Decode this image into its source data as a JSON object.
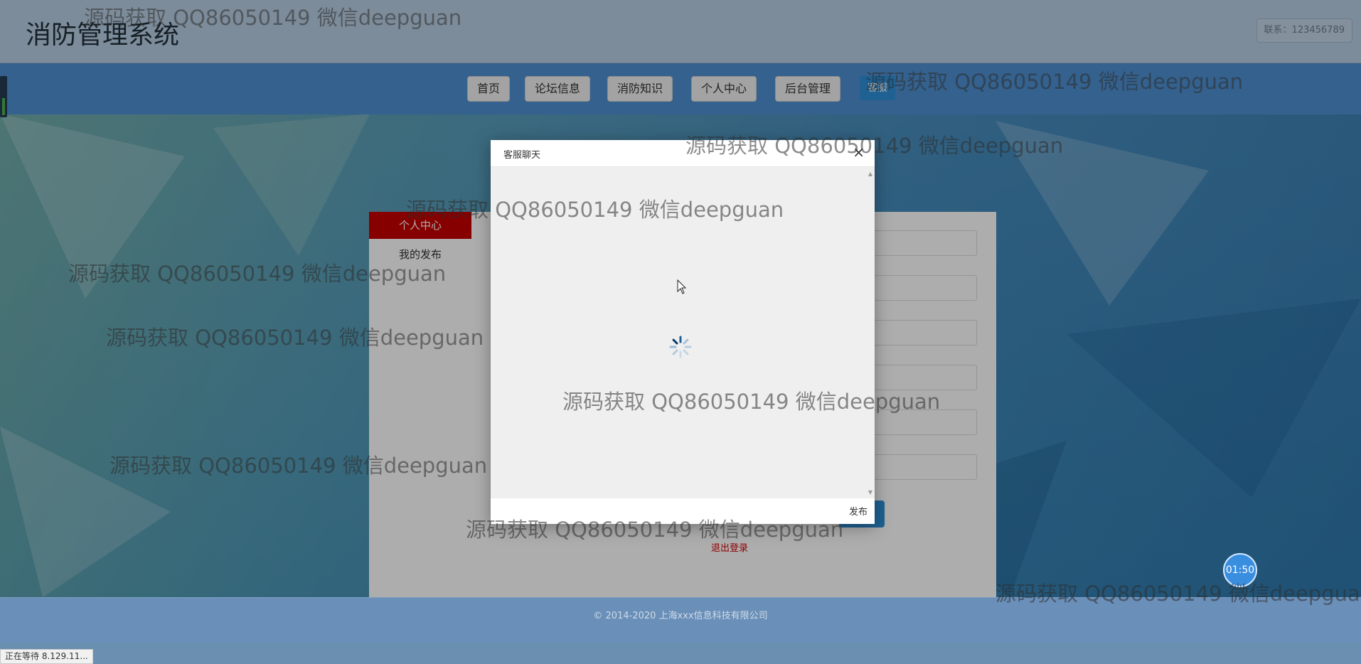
{
  "header": {
    "title": "消防管理系统",
    "contact": "联系：123456789"
  },
  "nav": {
    "items": [
      "首页",
      "论坛信息",
      "消防知识",
      "个人中心",
      "后台管理"
    ],
    "kefu_label": "客服"
  },
  "side_menu": {
    "active": "个人中心",
    "item": "我的发布"
  },
  "logout": "退出登录",
  "modal": {
    "title": "客服聊天",
    "close": "×",
    "send": "发布"
  },
  "clock": "01:50",
  "footer": {
    "copyright": "© 2014-2020 上海xxx信息科技有限公司"
  },
  "status_bar": "正在等待 8.129.11...",
  "watermark": "源码获取 QQ86050149 微信deepguan"
}
